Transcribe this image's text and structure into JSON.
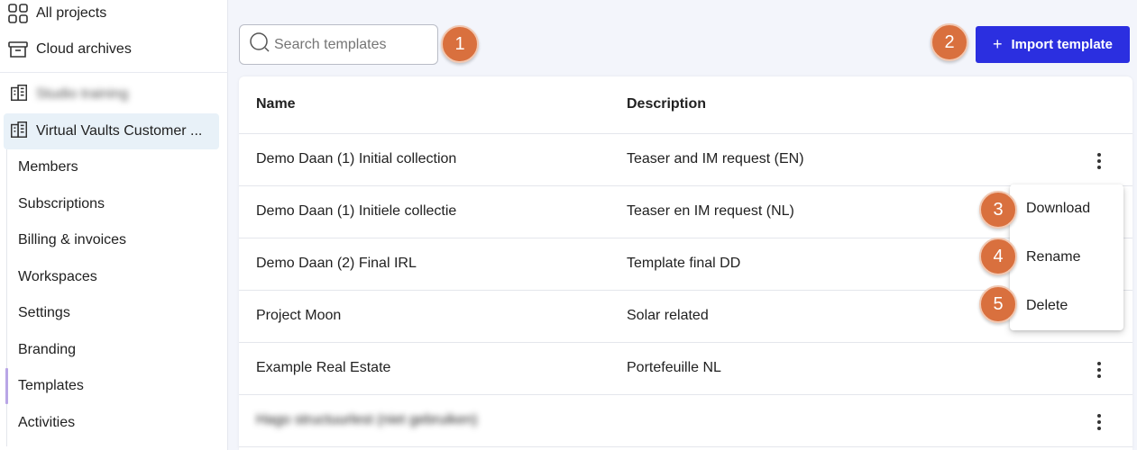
{
  "sidebar": {
    "top_items": [
      {
        "label": "All projects",
        "icon": "grid-icon"
      },
      {
        "label": "Cloud archives",
        "icon": "archive-icon"
      }
    ],
    "organizations": [
      {
        "label": "Studio training",
        "blurred": true,
        "icon": "building-icon"
      },
      {
        "label": "Virtual Vaults Customer ...",
        "blurred": false,
        "active": true,
        "icon": "building-icon"
      }
    ],
    "sub_items": [
      "Members",
      "Subscriptions",
      "Billing & invoices",
      "Workspaces",
      "Settings",
      "Branding",
      "Templates",
      "Activities"
    ],
    "active_sub_item": "Templates"
  },
  "search": {
    "placeholder": "Search templates",
    "value": ""
  },
  "toolbar": {
    "import_label": "Import template",
    "import_icon": "plus-icon"
  },
  "badges": [
    "1",
    "2",
    "3",
    "4",
    "5"
  ],
  "table": {
    "columns": [
      "Name",
      "Description"
    ],
    "rows": [
      {
        "name": "Demo Daan (1) Initial collection",
        "description": "Teaser and IM request (EN)"
      },
      {
        "name": "Demo Daan (1) Initiele collectie",
        "description": "Teaser en IM request (NL)"
      },
      {
        "name": "Demo Daan (2) Final IRL",
        "description": "Template final DD"
      },
      {
        "name": "Project Moon",
        "description": "Solar related"
      },
      {
        "name": "Example Real Estate",
        "description": "Portefeuille NL"
      },
      {
        "name": "Hago structuurlest (niet gebruiken)",
        "description": "",
        "blurred": true
      }
    ]
  },
  "context_menu": {
    "items": [
      "Download",
      "Rename",
      "Delete"
    ]
  },
  "colors": {
    "primary": "#2b2fe0",
    "badge": "#d9703e",
    "active_org_bg": "#e8f1f8",
    "background": "#f3f5fb"
  }
}
